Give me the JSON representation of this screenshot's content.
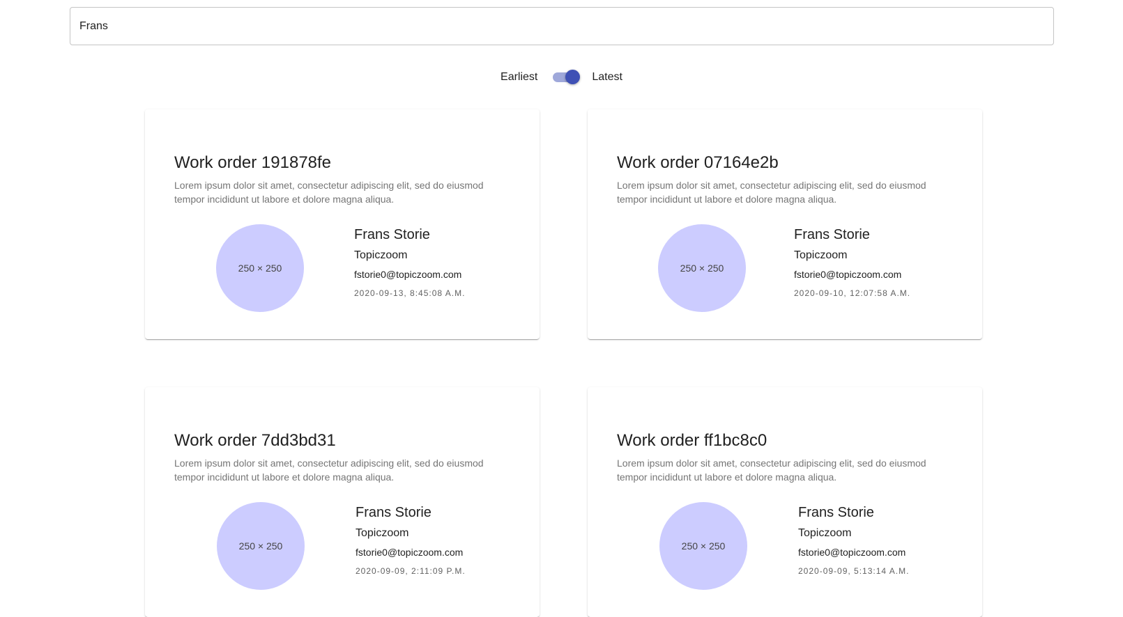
{
  "search": {
    "value": "Frans"
  },
  "sort": {
    "left_label": "Earliest",
    "right_label": "Latest",
    "selected": "Latest"
  },
  "colors": {
    "accent": "#3f51b5",
    "avatar_bg": "#ccccff"
  },
  "cards": [
    {
      "title": "Work order 191878fe",
      "description": "Lorem ipsum dolor sit amet, consectetur adipiscing elit, sed do eiusmod tempor incididunt ut labore et dolore magna aliqua.",
      "avatar_text": "250 × 250",
      "name": "Frans Storie",
      "company": "Topiczoom",
      "email": "fstorie0@topiczoom.com",
      "date": "2020-09-13, 8:45:08 A.M."
    },
    {
      "title": "Work order 07164e2b",
      "description": "Lorem ipsum dolor sit amet, consectetur adipiscing elit, sed do eiusmod tempor incididunt ut labore et dolore magna aliqua.",
      "avatar_text": "250 × 250",
      "name": "Frans Storie",
      "company": "Topiczoom",
      "email": "fstorie0@topiczoom.com",
      "date": "2020-09-10, 12:07:58 A.M."
    },
    {
      "title": "Work order 7dd3bd31",
      "description": "Lorem ipsum dolor sit amet, consectetur adipiscing elit, sed do eiusmod tempor incididunt ut labore et dolore magna aliqua.",
      "avatar_text": "250 × 250",
      "name": "Frans Storie",
      "company": "Topiczoom",
      "email": "fstorie0@topiczoom.com",
      "date": "2020-09-09, 2:11:09 P.M."
    },
    {
      "title": "Work order ff1bc8c0",
      "description": "Lorem ipsum dolor sit amet, consectetur adipiscing elit, sed do eiusmod tempor incididunt ut labore et dolore magna aliqua.",
      "avatar_text": "250 × 250",
      "name": "Frans Storie",
      "company": "Topiczoom",
      "email": "fstorie0@topiczoom.com",
      "date": "2020-09-09, 5:13:14 A.M."
    }
  ]
}
